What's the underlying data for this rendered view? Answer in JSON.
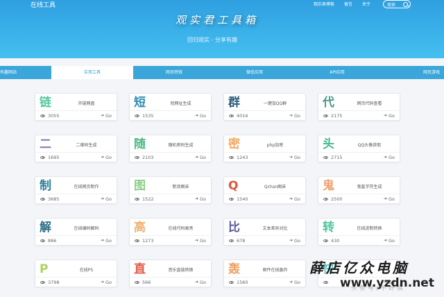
{
  "site": {
    "name": "在线工具"
  },
  "top_nav": [
    "观实君博客",
    "留言",
    "关于"
  ],
  "search": {
    "placeholder": "搜索"
  },
  "hero": {
    "title": "观实君工具箱",
    "subtitle": "回归观实 - 分享有趣"
  },
  "tabs": [
    {
      "label": "有趣网站",
      "active": false
    },
    {
      "label": "实用工具",
      "active": true
    },
    {
      "label": "网页特效",
      "active": false
    },
    {
      "label": "微信应用",
      "active": false
    },
    {
      "label": "API应用",
      "active": false
    },
    {
      "label": "网页游戏",
      "active": false
    }
  ],
  "colors": {
    "hero": "#3bb3ea",
    "tab_bar": "#3aa6d9",
    "active_tab_text": "#2aa0d8"
  },
  "go_label": "Go",
  "cards": [
    {
      "glyph": "链",
      "color": "#58c89a",
      "name": "外链网盘",
      "views": "3055",
      "icon": "eye-icon"
    },
    {
      "glyph": "短",
      "color": "#2f8db0",
      "name": "短网址生成",
      "views": "1535",
      "icon": "eye-icon"
    },
    {
      "glyph": "群",
      "color": "#2d5c7a",
      "name": "一键加QQ群",
      "views": "4016",
      "icon": "eye-icon"
    },
    {
      "glyph": "代",
      "color": "#4a9a8a",
      "name": "网页代码查看",
      "views": "2175",
      "icon": "eye-icon"
    },
    {
      "glyph": "二",
      "color": "#8a7ab8",
      "name": "二维码生成",
      "views": "1695",
      "icon": "eye-icon"
    },
    {
      "glyph": "随",
      "color": "#4db883",
      "name": "随机密码生成",
      "views": "2103",
      "icon": "eye-icon"
    },
    {
      "glyph": "密",
      "color": "#f0a860",
      "name": "php加密",
      "views": "1243",
      "icon": "eye-icon"
    },
    {
      "glyph": "头",
      "color": "#3cb88a",
      "name": "QQ头像获取",
      "views": "2715",
      "icon": "eye-icon"
    },
    {
      "glyph": "制",
      "color": "#2e7d98",
      "name": "在线网页制作",
      "views": "3685",
      "icon": "eye-icon"
    },
    {
      "glyph": "图",
      "color": "#8fcf8a",
      "name": "新浪图床",
      "views": "1522",
      "icon": "eye-icon"
    },
    {
      "glyph": "Q",
      "color": "#e0543c",
      "name": "Qchan图床",
      "views": "1540",
      "icon": "eye-icon"
    },
    {
      "glyph": "鬼",
      "color": "#f0a070",
      "name": "鬼畜字符生成",
      "views": "2500",
      "icon": "eye-icon"
    },
    {
      "glyph": "解",
      "color": "#2d6f88",
      "name": "在线编码解码",
      "views": "886",
      "icon": "eye-icon"
    },
    {
      "glyph": "高",
      "color": "#f0b070",
      "name": "在线代码高亮",
      "views": "1273",
      "icon": "eye-icon"
    },
    {
      "glyph": "比",
      "color": "#5a5a9a",
      "name": "文本差异对比",
      "views": "678",
      "icon": "eye-icon"
    },
    {
      "glyph": "转",
      "color": "#4ec49a",
      "name": "在线进制转换",
      "views": "430",
      "icon": "eye-icon"
    },
    {
      "glyph": "P",
      "color": "#b0d060",
      "name": "在线PS",
      "views": "3798",
      "icon": "eye-icon"
    },
    {
      "glyph": "直",
      "color": "#e05a48",
      "name": "音乐直链转换",
      "views": "566",
      "icon": "eye-icon"
    },
    {
      "glyph": "轰",
      "color": "#f0a060",
      "name": "邮件在线轰炸",
      "views": "1560",
      "icon": "eye-icon"
    },
    {
      "glyph": "快",
      "color": "#58c8c0",
      "name": "",
      "views": "",
      "icon": "eye-icon"
    }
  ],
  "watermark": {
    "cn": "薛店亿众电脑",
    "url": "www.yzdn.net",
    "faint": "头条号/不好撰"
  }
}
